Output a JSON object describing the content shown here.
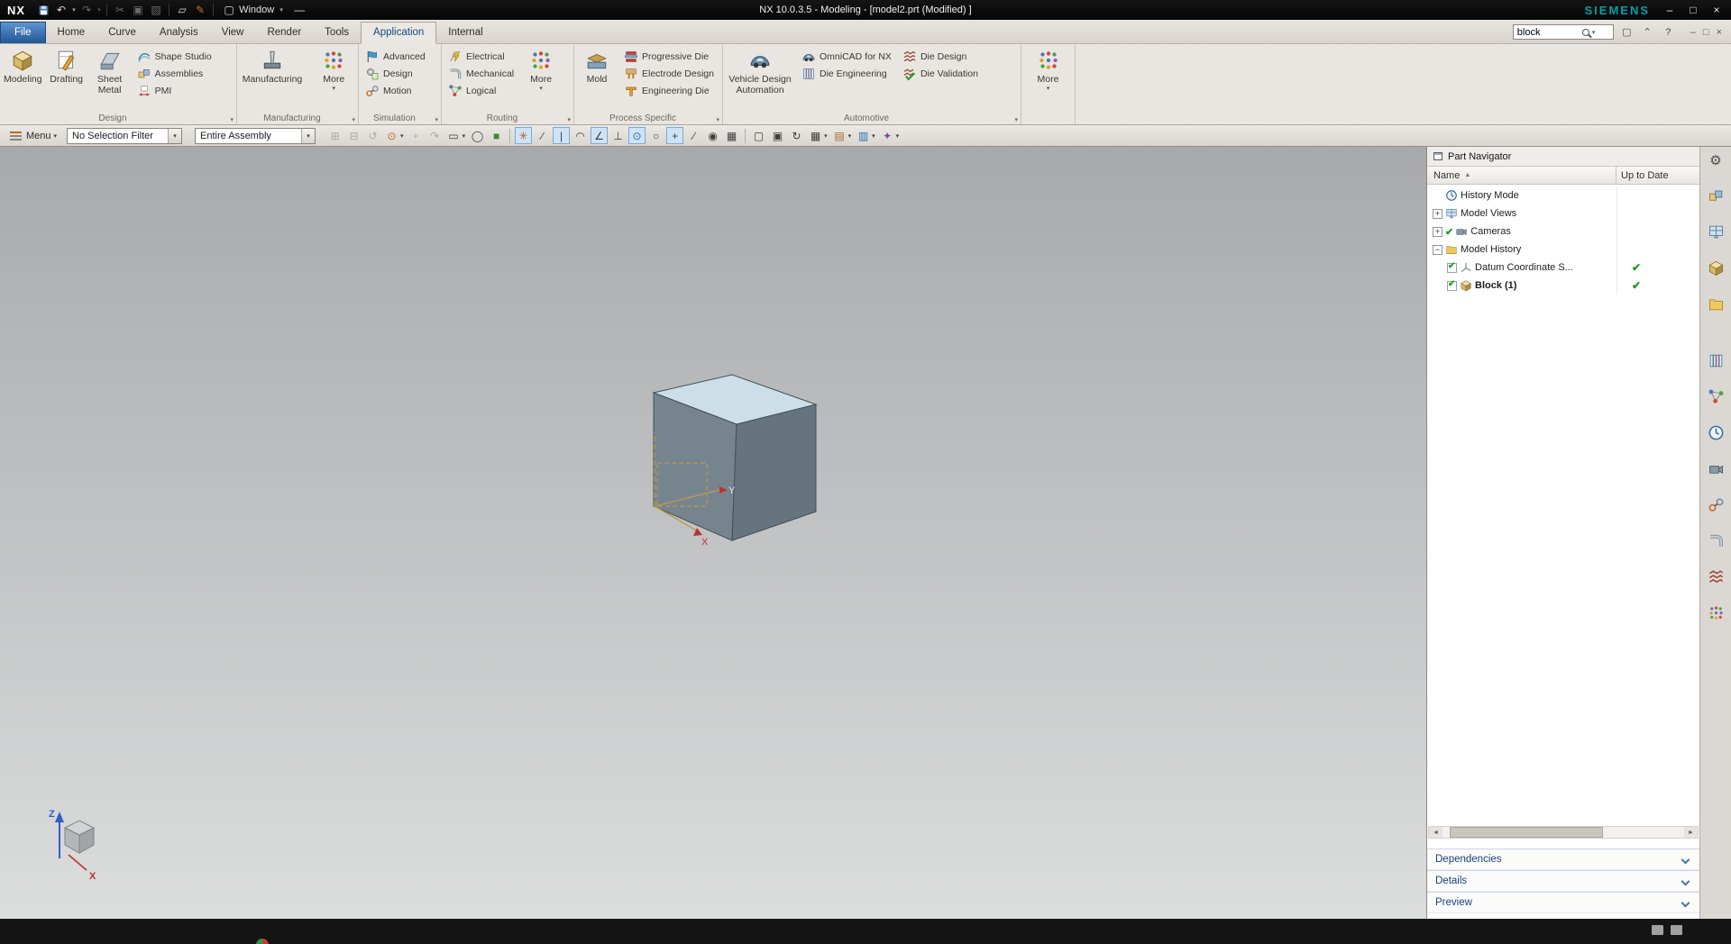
{
  "icons": {
    "chevron_down": "▾",
    "chevron_up": "⌃",
    "sort_asc": "▲",
    "check": "✔",
    "box_plus": "+",
    "box_minus": "−",
    "gear": "⚙",
    "undo": "↶",
    "redo": "↷",
    "cut": "✂",
    "copy": "▣",
    "paste": "▨",
    "window": "▢",
    "help": "?",
    "minimize": "–",
    "maximize": "□",
    "close": "×",
    "left_arrow": "◄",
    "right_arrow": "►",
    "dash": "—",
    "touch": "▱",
    "pen": "✎"
  },
  "titlebar": {
    "logo": "NX",
    "window_menu": "Window",
    "title": "NX 10.0.3.5 - Modeling - [model2.prt (Modified) ]",
    "brand": "SIEMENS"
  },
  "tabs": {
    "file": "File",
    "home": "Home",
    "curve": "Curve",
    "analysis": "Analysis",
    "view": "View",
    "render": "Render",
    "tools": "Tools",
    "application": "Application",
    "internal": "Internal"
  },
  "search": {
    "value": "block"
  },
  "ribbon": {
    "design": {
      "label": "Design",
      "modeling": "Modeling",
      "drafting": "Drafting",
      "sheet_metal": "Sheet Metal",
      "shape_studio": "Shape Studio",
      "assemblies": "Assemblies",
      "pmi": "PMI"
    },
    "manufacturing": {
      "label": "Manufacturing",
      "manufacturing": "Manufacturing",
      "more": "More"
    },
    "simulation": {
      "label": "Simulation",
      "advanced": "Advanced",
      "design": "Design",
      "motion": "Motion"
    },
    "routing": {
      "label": "Routing",
      "electrical": "Electrical",
      "mechanical": "Mechanical",
      "logical": "Logical",
      "more": "More"
    },
    "process": {
      "label": "Process Specific",
      "mold": "Mold",
      "progressive_die": "Progressive Die",
      "electrode_design": "Electrode Design",
      "engineering_die": "Engineering Die"
    },
    "automotive": {
      "label": "Automotive",
      "vehicle_design": "Vehicle Design Automation",
      "omnicad": "OmniCAD for NX",
      "die_engineering": "Die Engineering",
      "die_design": "Die Design",
      "die_validation": "Die Validation"
    },
    "overflow_more": "More"
  },
  "toolbar": {
    "menu": "Menu",
    "selection_filter": "No Selection Filter",
    "scope": "Entire Assembly"
  },
  "tb_icons": [
    "⊞",
    "⊟",
    "↺",
    "⊙",
    "+",
    "↷",
    "▭",
    "◯",
    "■",
    "✳",
    "∕",
    "|",
    "◠",
    "∠",
    "⊥",
    "⊙",
    "○",
    "+",
    "∕",
    "◉",
    "▦",
    "▢",
    "▣",
    "↻",
    "▦",
    "▤",
    "▥",
    "✦"
  ],
  "part_navigator": {
    "title": "Part Navigator",
    "columns": {
      "name": "Name",
      "up_to_date": "Up to Date"
    },
    "rows": [
      {
        "label": "History Mode"
      },
      {
        "label": "Model Views"
      },
      {
        "label": "Cameras"
      },
      {
        "label": "Model History"
      },
      {
        "label": "Datum Coordinate S..."
      },
      {
        "label": "Block (1)"
      }
    ],
    "sections": {
      "dependencies": "Dependencies",
      "details": "Details",
      "preview": "Preview"
    }
  },
  "viewport": {
    "axis": {
      "x": "X",
      "y": "Y",
      "z": "Z"
    },
    "triad": {
      "x": "X",
      "z": "Z"
    }
  },
  "colors": {
    "accent_blue": "#17497f",
    "up_to_date_green": "#18a018",
    "siemens_teal": "#00a0a6"
  }
}
